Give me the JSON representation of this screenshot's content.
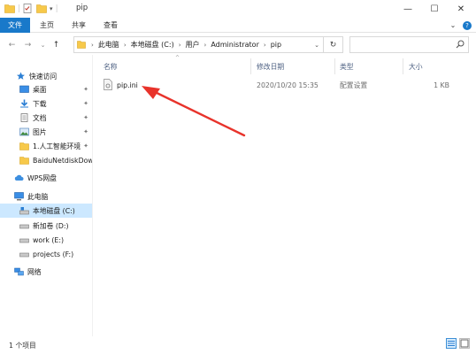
{
  "window": {
    "title": "pip",
    "minimize_glyph": "—",
    "maximize_glyph": "☐",
    "close_glyph": "✕",
    "separator": "|"
  },
  "ribbon": {
    "tabs": [
      "文件",
      "主页",
      "共享",
      "查看"
    ],
    "expand_glyph": "⌄",
    "help_glyph": "?"
  },
  "address": {
    "back_glyph": "←",
    "forward_glyph": "→",
    "recent_glyph": "⌄",
    "up_glyph": "↑",
    "crumbs": [
      "此电脑",
      "本地磁盘 (C:)",
      "用户",
      "Administrator",
      "pip"
    ],
    "crumb_separator": "›",
    "dropdown_glyph": "⌄",
    "refresh_glyph": "↻",
    "search_placeholder": ""
  },
  "sidebar": {
    "quick_access": "快速访问",
    "items": [
      {
        "label": "桌面",
        "icon": "desktop-icon",
        "pinned": true
      },
      {
        "label": "下载",
        "icon": "download-icon",
        "pinned": true
      },
      {
        "label": "文档",
        "icon": "documents-icon",
        "pinned": true
      },
      {
        "label": "图片",
        "icon": "pictures-icon",
        "pinned": true
      },
      {
        "label": "1.人工智能环境",
        "icon": "folder-icon",
        "pinned": true
      },
      {
        "label": "BaiduNetdiskDow",
        "icon": "folder-icon",
        "pinned": false
      }
    ],
    "pin_glyph": "✦",
    "wps": "WPS网盘",
    "this_pc": "此电脑",
    "drives": [
      {
        "label": "本地磁盘 (C:)",
        "selected": true
      },
      {
        "label": "新加卷 (D:)",
        "selected": false
      },
      {
        "label": "work (E:)",
        "selected": false
      },
      {
        "label": "projects (F:)",
        "selected": false
      }
    ],
    "network": "网络"
  },
  "columns": {
    "name": "名称",
    "modified": "修改日期",
    "type": "类型",
    "size": "大小",
    "sort_glyph": "^"
  },
  "files": [
    {
      "name": "pip.ini",
      "modified": "2020/10/20 15:35",
      "type": "配置设置",
      "size": "1 KB"
    }
  ],
  "annotation": {
    "color": "#e8332b"
  },
  "status": {
    "count": "1 个项目"
  },
  "colors": {
    "accent": "#1979ca",
    "selected": "#cce8ff",
    "folder": "#f7c94a"
  }
}
